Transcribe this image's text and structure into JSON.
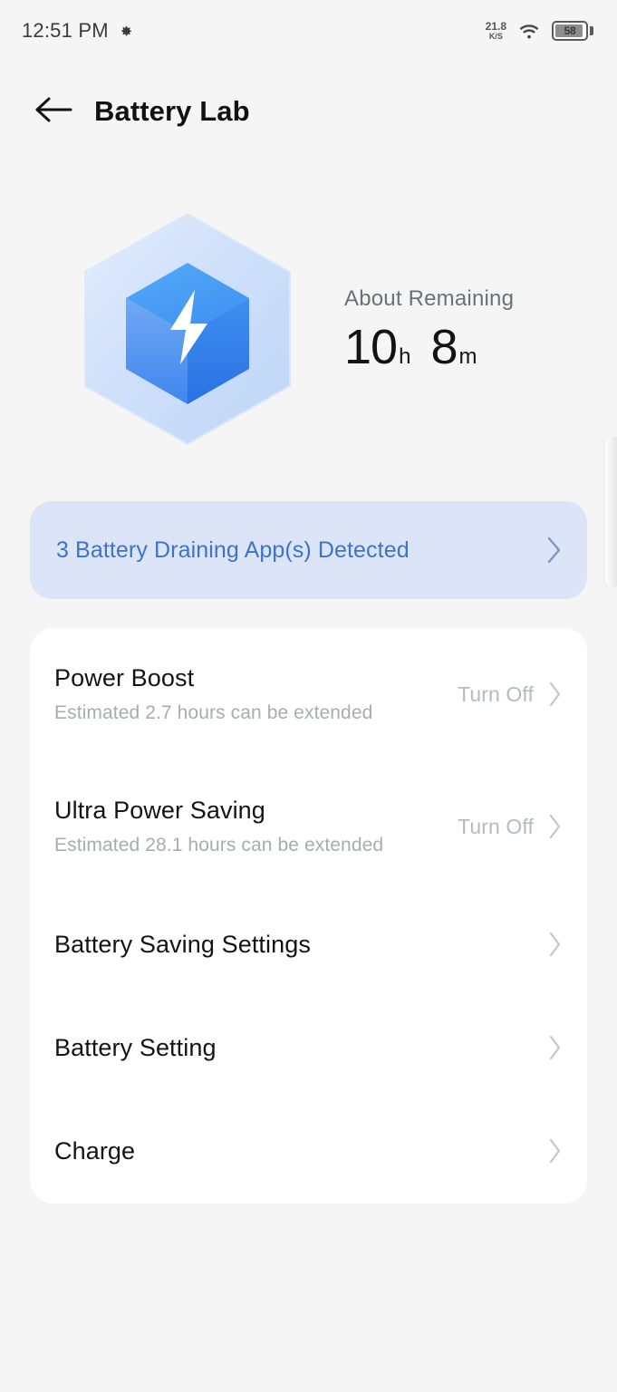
{
  "status_bar": {
    "time": "12:51 PM",
    "gear_icon": "gear-icon",
    "network_speed_value": "21.8",
    "network_speed_unit": "K/S",
    "wifi_icon": "wifi-icon",
    "battery_level": "58",
    "battery_icon": "battery-icon"
  },
  "header": {
    "back_icon": "arrow-left-icon",
    "title": "Battery Lab"
  },
  "hero": {
    "icon": "battery-cube-icon",
    "label": "About Remaining",
    "hours_value": "10",
    "hours_unit": "h",
    "minutes_value": "8",
    "minutes_unit": "m"
  },
  "banner": {
    "text": "3 Battery Draining App(s) Detected",
    "chevron_icon": "chevron-right-icon",
    "text_color": "#3f73c9",
    "background_color": "#dce5f8"
  },
  "list": {
    "rows": [
      {
        "title": "Power Boost",
        "subtitle": "Estimated 2.7 hours can be extended",
        "action": "Turn Off",
        "chevron_icon": "chevron-right-icon"
      },
      {
        "title": "Ultra Power Saving",
        "subtitle": "Estimated 28.1 hours can be extended",
        "action": "Turn Off",
        "chevron_icon": "chevron-right-icon"
      },
      {
        "title": "Battery Saving Settings",
        "subtitle": "",
        "action": "",
        "chevron_icon": "chevron-right-icon"
      },
      {
        "title": "Battery Setting",
        "subtitle": "",
        "action": "",
        "chevron_icon": "chevron-right-icon"
      },
      {
        "title": "Charge",
        "subtitle": "",
        "action": "",
        "chevron_icon": "chevron-right-icon"
      }
    ]
  },
  "theme": {
    "page_background": "#f5f5f5",
    "card_background": "#ffffff",
    "accent_blue": "#3f73c9",
    "cube_blue": "#4da3f5"
  }
}
